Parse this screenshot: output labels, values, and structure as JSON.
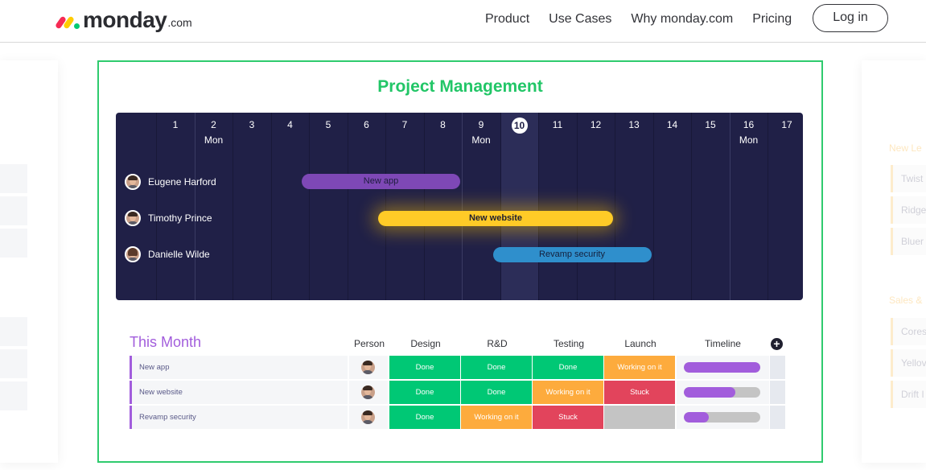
{
  "header": {
    "logo_word": "monday",
    "logo_suffix": ".com",
    "nav": [
      "Product",
      "Use Cases",
      "Why monday.com",
      "Pricing"
    ],
    "login_label": "Log in"
  },
  "side_right": {
    "groups": [
      "New Le",
      "Sales &"
    ],
    "items_top": [
      "Twist",
      "Ridge",
      "Bluer"
    ],
    "items_bottom": [
      "Cores",
      "Yellov",
      "Drift I"
    ]
  },
  "card": {
    "title": "Project Management",
    "gantt": {
      "days": [
        {
          "num": "1",
          "sub": ""
        },
        {
          "num": "2",
          "sub": "Mon"
        },
        {
          "num": "3",
          "sub": ""
        },
        {
          "num": "4",
          "sub": ""
        },
        {
          "num": "5",
          "sub": ""
        },
        {
          "num": "6",
          "sub": ""
        },
        {
          "num": "7",
          "sub": ""
        },
        {
          "num": "8",
          "sub": ""
        },
        {
          "num": "9",
          "sub": "Mon"
        },
        {
          "num": "10",
          "sub": "",
          "today": true
        },
        {
          "num": "11",
          "sub": ""
        },
        {
          "num": "12",
          "sub": ""
        },
        {
          "num": "13",
          "sub": ""
        },
        {
          "num": "14",
          "sub": ""
        },
        {
          "num": "15",
          "sub": ""
        },
        {
          "num": "16",
          "sub": "Mon"
        },
        {
          "num": "17",
          "sub": ""
        }
      ],
      "people": [
        "Eugene Harford",
        "Timothy Prince",
        "Danielle Wilde"
      ],
      "bars": [
        {
          "label": "New app",
          "color": "#7e48b6",
          "start": 5,
          "end": 8
        },
        {
          "label": "New website",
          "color": "#ffcb27",
          "start": 7,
          "end": 12
        },
        {
          "label": "Revamp security",
          "color": "#2f8fcc",
          "start": 10,
          "end": 13
        }
      ]
    },
    "table": {
      "title": "This Month",
      "columns": [
        "Person",
        "Design",
        "R&D",
        "Testing",
        "Launch",
        "Timeline"
      ],
      "rows": [
        {
          "name": "New app",
          "design": "Done",
          "rd": "Done",
          "testing": "Done",
          "launch": "Working on it",
          "timeline_progress": 1.0
        },
        {
          "name": "New website",
          "design": "Done",
          "rd": "Done",
          "testing": "Working on it",
          "launch": "Stuck",
          "timeline_progress": 0.67
        },
        {
          "name": "Revamp security",
          "design": "Done",
          "rd": "Working on it",
          "testing": "Stuck",
          "launch": "",
          "timeline_progress": 0.33
        }
      ],
      "status_colors": {
        "Done": "#00c875",
        "Working on it": "#fdab3d",
        "Stuck": "#e2445c",
        "empty": "#c4c4c4"
      }
    }
  }
}
